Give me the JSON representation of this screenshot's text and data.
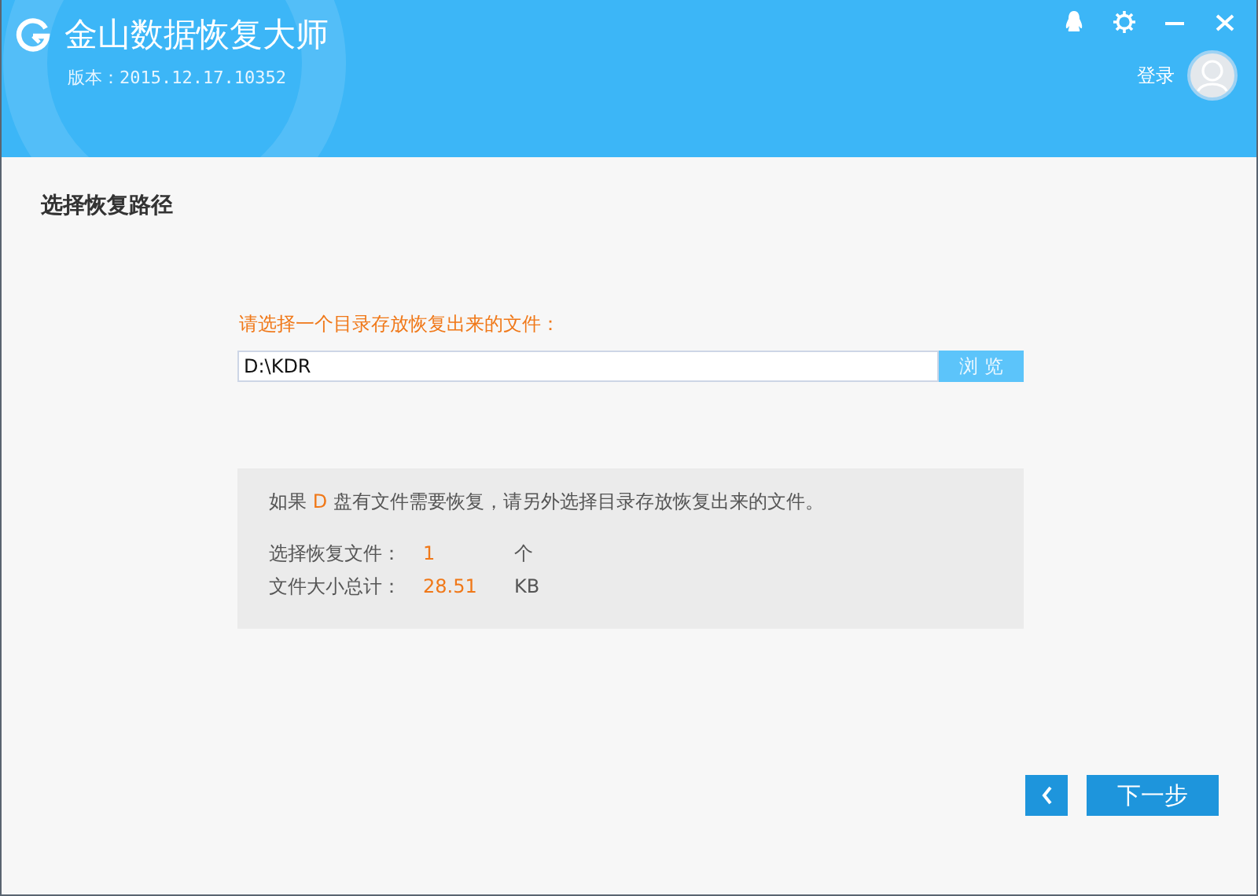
{
  "header": {
    "title": "金山数据恢复大师",
    "version": "版本：2015.12.17.10352",
    "login": "登录"
  },
  "section_title": "选择恢复路径",
  "path_prompt": "请选择一个目录存放恢复出来的文件：",
  "path_field": {
    "value": "D:\\KDR"
  },
  "browse_button": "浏 览",
  "notice": {
    "before": "如果",
    "drive": "D",
    "after": "盘有文件需要恢复，请另外选择目录存放恢复出来的文件。"
  },
  "stats": [
    {
      "label": "选择恢复文件：",
      "value": "1",
      "unit": "个"
    },
    {
      "label": "文件大小总计：",
      "value": "28.51",
      "unit": "KB"
    }
  ],
  "next_button": "下一步"
}
